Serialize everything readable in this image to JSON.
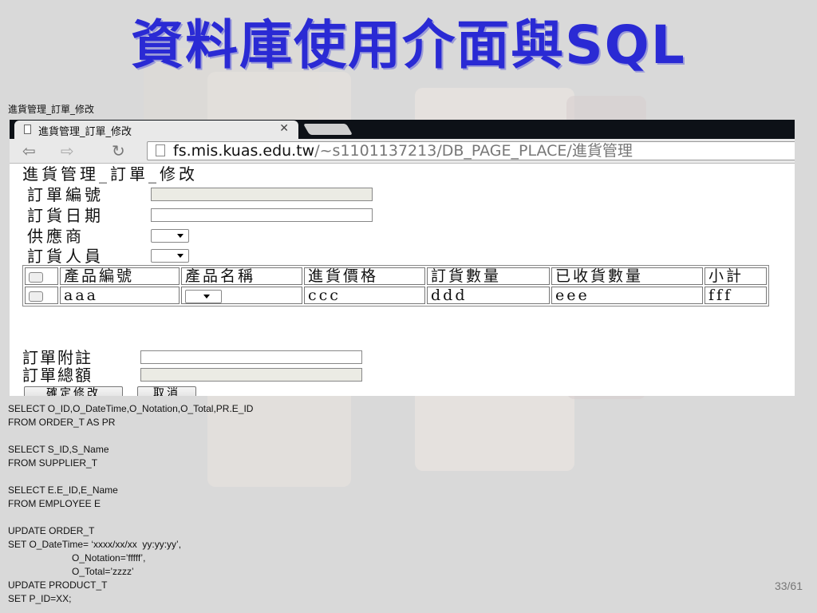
{
  "slide": {
    "title": "資料庫使用介面與SQL",
    "caption": "進貨管理_訂單_修改",
    "page_number": "33/61"
  },
  "browser": {
    "tab_title": "進貨管理_訂單_修改",
    "url_host": "fs.mis.kuas.edu.tw",
    "url_path": "/~s1101137213/DB_PAGE_PLACE/進貨管理"
  },
  "form": {
    "heading": "進貨管理_訂單_修改",
    "order_id_label": "訂單編號",
    "order_date_label": "訂貨日期",
    "supplier_label": "供應商",
    "staff_label": "訂貨人員",
    "columns": [
      "產品編號",
      "產品名稱",
      "進貨價格",
      "訂貨數量",
      "已收貨數量",
      "小計"
    ],
    "row": {
      "product_id": "aaa",
      "price": "ccc",
      "quantity": "ddd",
      "received": "eee",
      "subtotal": "fff"
    },
    "notes_label": "訂單附註",
    "total_label": "訂單總額",
    "confirm_button": "確定修改",
    "cancel_button": "取消"
  },
  "sql_lines": [
    "SELECT O_ID,O_DateTime,O_Notation,O_Total,PR.E_ID",
    "FROM ORDER_T AS PR",
    "",
    "SELECT S_ID,S_Name",
    "FROM SUPPLIER_T",
    "",
    "SELECT E.E_ID,E_Name",
    "FROM EMPLOYEE E",
    "",
    "UPDATE ORDER_T",
    "SET O_DateTime= ‘xxxx/xx/xx  yy:yy:yy’,",
    "                        O_Notation=’fffff’,",
    "                        O_Total=’zzzz’",
    "UPDATE PRODUCT_T",
    "SET P_ID=XX;"
  ]
}
